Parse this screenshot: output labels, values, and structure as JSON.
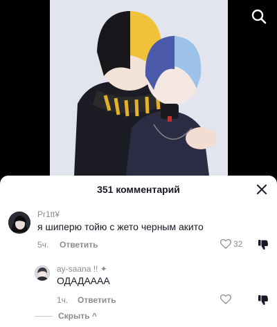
{
  "header": {
    "search_icon": "search-icon"
  },
  "comments_sheet": {
    "title": "351 комментарий",
    "close_icon": "close-icon"
  },
  "comments": [
    {
      "username": "Pr1tt¥",
      "text": "я шиперю тойю с жето черным акито",
      "time": "5ч.",
      "reply_label": "Ответить",
      "like_count": "32"
    }
  ],
  "replies": [
    {
      "username": "ay-saana !! ✦",
      "text": "ОДАДАААА",
      "time": "1ч.",
      "reply_label": "Ответить"
    }
  ],
  "hide_replies_label": "Скрыть ^",
  "colors": {
    "text_primary": "#161823",
    "text_secondary": "#8a8b91",
    "sheet_bg": "#ffffff"
  }
}
